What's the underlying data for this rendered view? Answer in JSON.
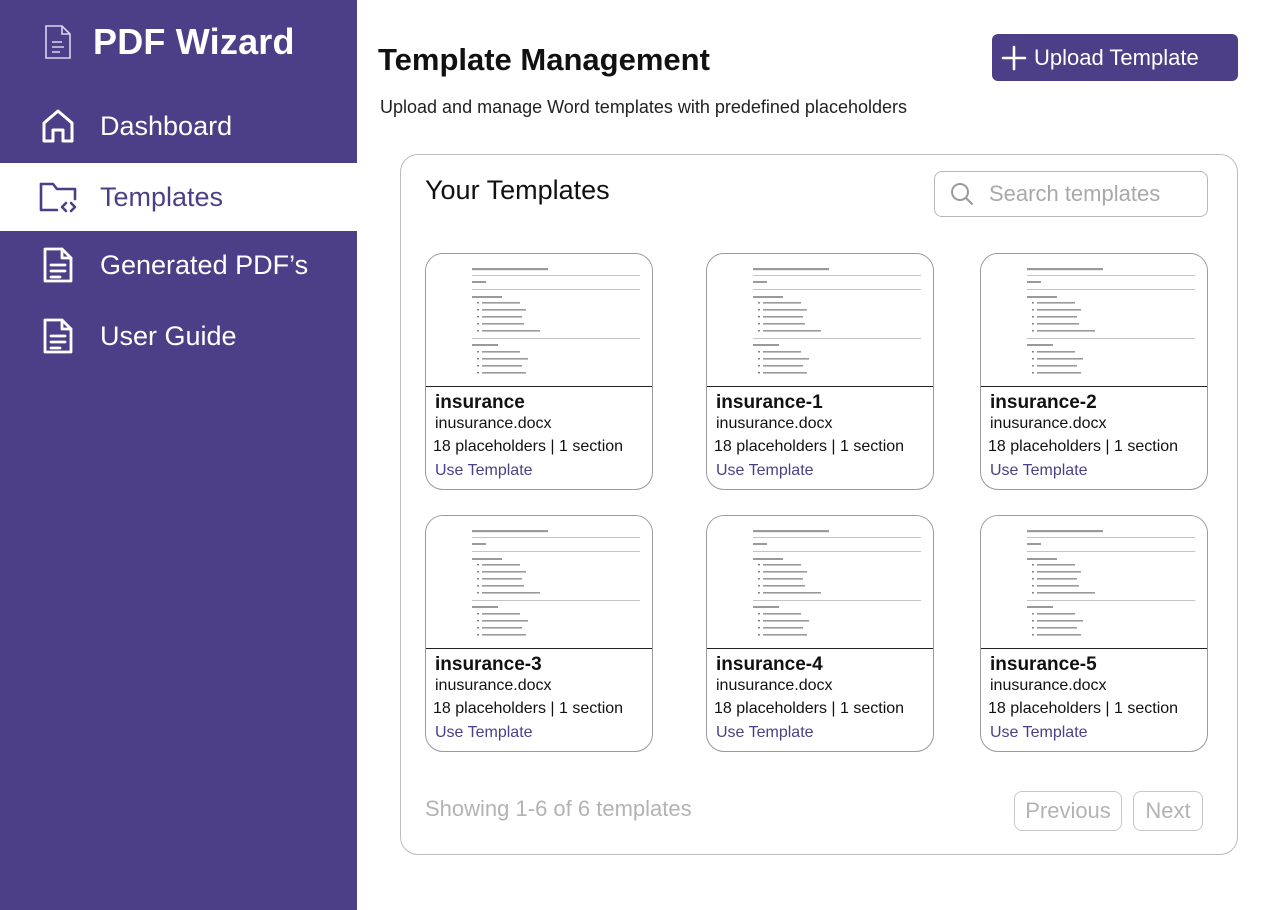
{
  "app": {
    "title": "PDF Wizard",
    "icon": "document-icon"
  },
  "sidebar": {
    "items": [
      {
        "label": "Dashboard",
        "icon": "home-icon",
        "active": false
      },
      {
        "label": "Templates",
        "icon": "folder-code-icon",
        "active": true
      },
      {
        "label": "Generated PDF’s",
        "icon": "file-text-icon",
        "active": false
      },
      {
        "label": "User Guide",
        "icon": "file-text-icon",
        "active": false
      }
    ]
  },
  "header": {
    "title": "Template Management",
    "subtitle": "Upload and manage Word templates with predefined placeholders",
    "upload_label": "Upload Template"
  },
  "panel": {
    "title": "Your Templates",
    "search_placeholder": "Search templates"
  },
  "templates": [
    {
      "name": "insurance",
      "file": "inusurance.docx",
      "meta": "18 placeholders | 1 section",
      "action": "Use Template"
    },
    {
      "name": "insurance-1",
      "file": "inusurance.docx",
      "meta": "18 placeholders | 1 section",
      "action": "Use Template"
    },
    {
      "name": "insurance-2",
      "file": "inusurance.docx",
      "meta": "18 placeholders | 1 section",
      "action": "Use Template"
    },
    {
      "name": "insurance-3",
      "file": "inusurance.docx",
      "meta": "18 placeholders | 1 section",
      "action": "Use Template"
    },
    {
      "name": "insurance-4",
      "file": "inusurance.docx",
      "meta": "18 placeholders | 1 section",
      "action": "Use Template"
    },
    {
      "name": "insurance-5",
      "file": "inusurance.docx",
      "meta": "18 placeholders | 1 section",
      "action": "Use Template"
    }
  ],
  "pagination": {
    "showing": "Showing 1-6 of 6 templates",
    "previous": "Previous",
    "next": "Next"
  },
  "colors": {
    "brand": "#4d3f87",
    "muted": "#b3b3b3"
  }
}
